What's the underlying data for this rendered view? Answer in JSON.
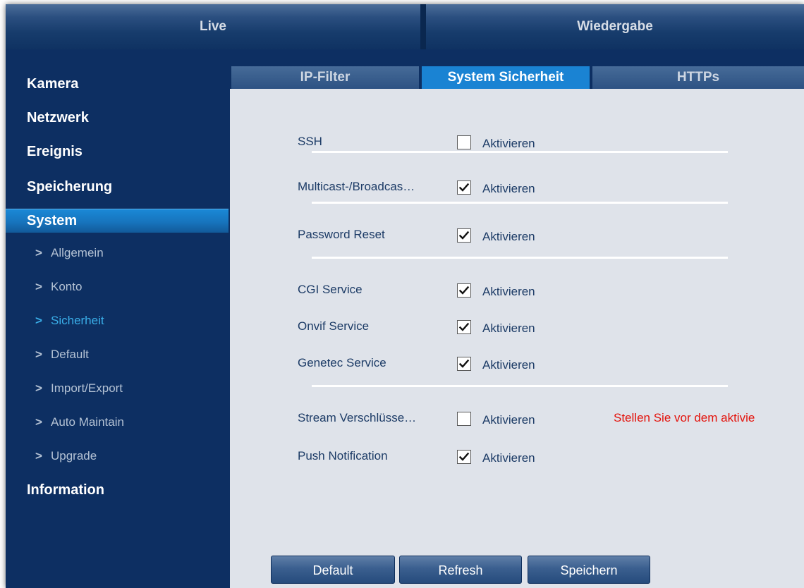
{
  "topnav": {
    "live": "Live",
    "playback": "Wiedergabe"
  },
  "sidebar": {
    "kamera": "Kamera",
    "netzwerk": "Netzwerk",
    "ereignis": "Ereignis",
    "speicherung": "Speicherung",
    "system": "System",
    "system_items": [
      "Allgemein",
      "Konto",
      "Sicherheit",
      "Default",
      "Import/Export",
      "Auto Maintain",
      "Upgrade"
    ],
    "current_item": "Sicherheit",
    "information": "Information",
    "chevron": ">"
  },
  "tabs": [
    "IP-Filter",
    "System Sicherheit",
    "HTTPs"
  ],
  "active_tab": "System Sicherheit",
  "settings": {
    "enable_label": "Aktivieren",
    "ssh": {
      "label": "SSH",
      "checked": false
    },
    "multicast": {
      "label": "Multicast-/Broadcas…",
      "checked": true
    },
    "password_reset": {
      "label": "Password Reset",
      "checked": true
    },
    "cgi": {
      "label": "CGI Service",
      "checked": true
    },
    "onvif": {
      "label": "Onvif Service",
      "checked": true
    },
    "genetec": {
      "label": "Genetec Service",
      "checked": true
    },
    "stream_encryption": {
      "label": "Stream Verschlüsse…",
      "checked": false,
      "warning": "Stellen Sie vor dem aktivie"
    },
    "push_notification": {
      "label": "Push Notification",
      "checked": true
    }
  },
  "buttons": {
    "default": "Default",
    "refresh": "Refresh",
    "save": "Speichern"
  },
  "colors": {
    "frame_bg": "#0d2f62",
    "accent": "#1a83d3",
    "content_bg": "#dfe3ea",
    "warning": "#e3120b"
  }
}
